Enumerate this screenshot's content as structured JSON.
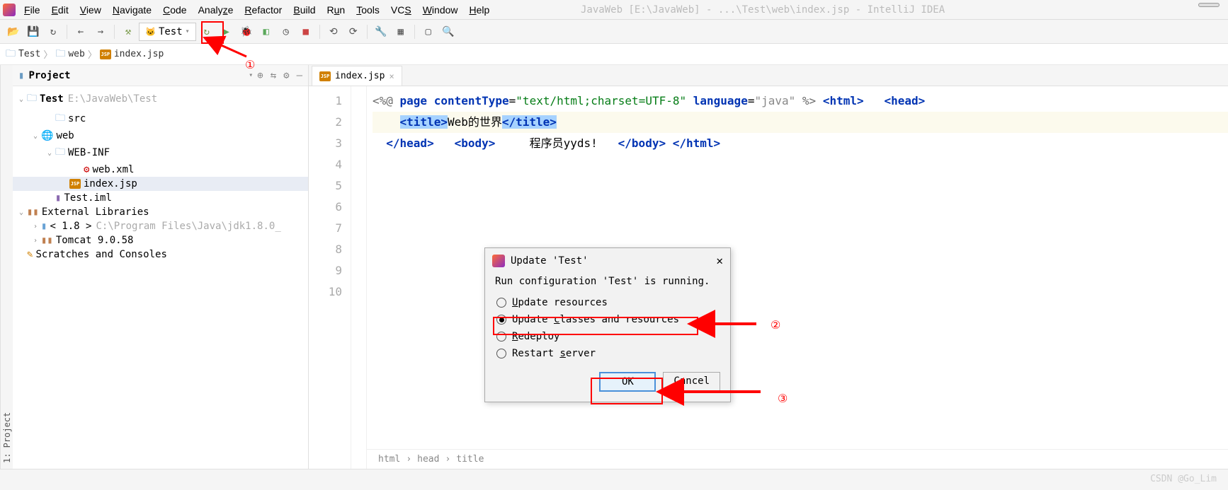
{
  "window": {
    "title": "JavaWeb [E:\\JavaWeb] - ...\\Test\\web\\index.jsp - IntelliJ IDEA"
  },
  "menu": {
    "file": "File",
    "edit": "Edit",
    "view": "View",
    "navigate": "Navigate",
    "code": "Code",
    "analyze": "Analyze",
    "refactor": "Refactor",
    "build": "Build",
    "run": "Run",
    "tools": "Tools",
    "vcs": "VCS",
    "window": "Window",
    "help": "Help"
  },
  "toolbar": {
    "run_config_label": "Test"
  },
  "breadcrumb": {
    "items": [
      "Test",
      "web",
      "index.jsp"
    ]
  },
  "sidebar": {
    "left_tab": "1: Project",
    "title": "Project",
    "tree": {
      "test": "Test",
      "test_hint": "E:\\JavaWeb\\Test",
      "src": "src",
      "web": "web",
      "webinf": "WEB-INF",
      "webxml": "web.xml",
      "indexjsp": "index.jsp",
      "testiml": "Test.iml",
      "extlib": "External Libraries",
      "jdk": "< 1.8 >",
      "jdk_hint": "C:\\Program Files\\Java\\jdk1.8.0_",
      "tomcat": "Tomcat 9.0.58",
      "scratch": "Scratches and Consoles"
    }
  },
  "editor": {
    "tab_label": "index.jsp",
    "lines": {
      "l1_a": "<%@ ",
      "l1_b": "page",
      "l1_c": " contentType",
      "l1_d": "=",
      "l1_e": "\"text/html;charset=UTF-8\"",
      "l1_f": " language",
      "l1_g": "=",
      "l1_h": "\"java\"",
      "l1_i": " %>",
      "l2": "<html>",
      "l3": "<head>",
      "l4_a": "<title>",
      "l4_b": "Web的世界",
      "l4_c": "</title>",
      "l5": "</head>",
      "l6": "<body>",
      "l7": "程序员yyds!",
      "l8": "</body>",
      "l9": "</html>"
    },
    "gutter": [
      "1",
      "2",
      "3",
      "4",
      "5",
      "6",
      "7",
      "8",
      "9",
      "10"
    ],
    "crumb": [
      "html",
      "head",
      "title"
    ]
  },
  "dialog": {
    "title": "Update 'Test'",
    "message": "Run configuration 'Test' is running.",
    "opt1": "Update resources",
    "opt2": "Update classes and resources",
    "opt3": "Redeploy",
    "opt4": "Restart server",
    "ok": "OK",
    "cancel": "Cancel"
  },
  "annotations": {
    "n1": "①",
    "n2": "②",
    "n3": "③"
  },
  "watermark": "CSDN @Go_Lim"
}
